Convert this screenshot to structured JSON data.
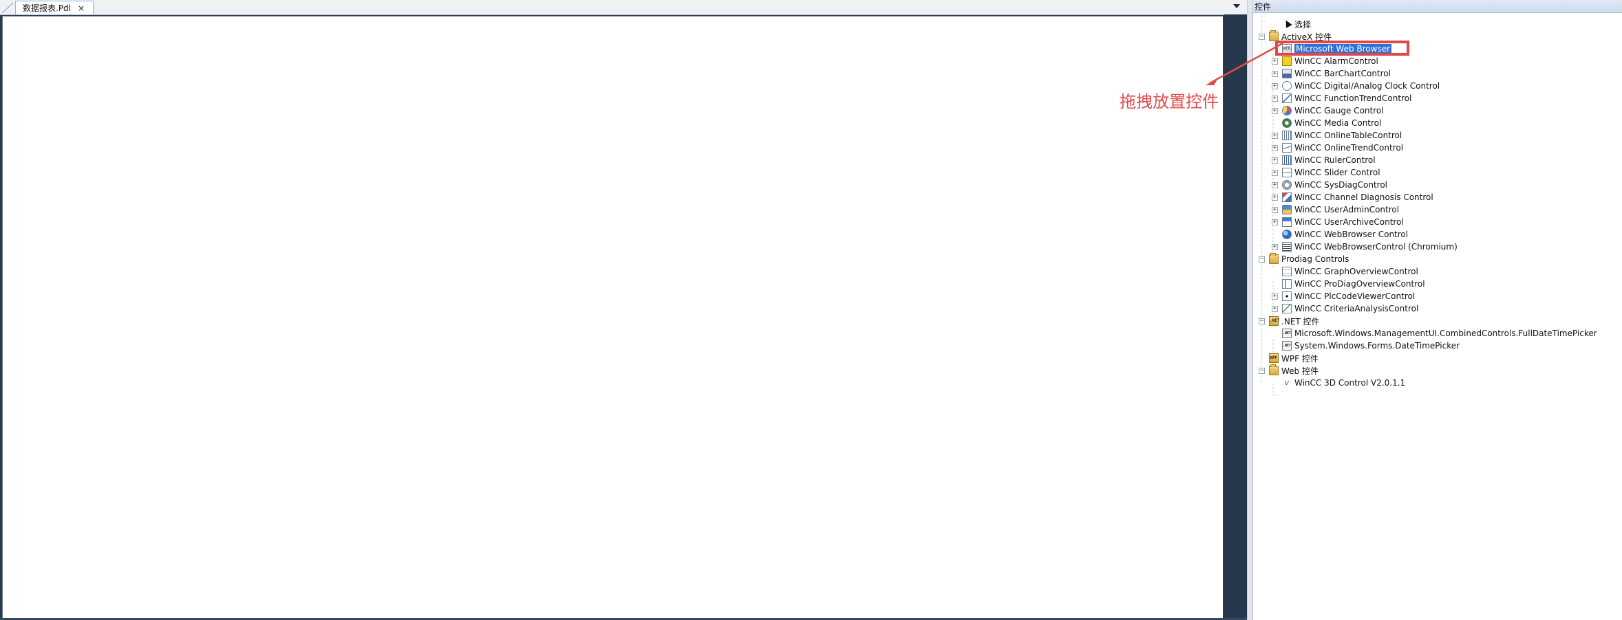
{
  "editor": {
    "tab_title": "数据报表.Pdl",
    "close_glyph": "×"
  },
  "panel": {
    "title": "控件",
    "tree": [
      {
        "label": "选择",
        "icon": "pointer-icon",
        "toggle": "",
        "indent": 1
      },
      {
        "label": "ActiveX 控件",
        "icon": "folder-icon",
        "toggle": "−",
        "indent": 0
      },
      {
        "label": "Microsoft Web Browser",
        "icon": "web-browser-icon",
        "toggle": "",
        "indent": 1,
        "selected": true
      },
      {
        "label": "WinCC AlarmControl",
        "icon": "alarm-control-icon",
        "toggle": "+",
        "indent": 1
      },
      {
        "label": "WinCC BarChartControl",
        "icon": "bar-chart-icon",
        "toggle": "+",
        "indent": 1
      },
      {
        "label": "WinCC Digital/Analog Clock Control",
        "icon": "clock-icon",
        "toggle": "+",
        "indent": 1
      },
      {
        "label": "WinCC FunctionTrendControl",
        "icon": "function-trend-icon",
        "toggle": "+",
        "indent": 1
      },
      {
        "label": "WinCC Gauge Control",
        "icon": "gauge-icon",
        "toggle": "+",
        "indent": 1
      },
      {
        "label": "WinCC Media Control",
        "icon": "media-icon",
        "toggle": "",
        "indent": 1
      },
      {
        "label": "WinCC OnlineTableControl",
        "icon": "online-table-icon",
        "toggle": "+",
        "indent": 1
      },
      {
        "label": "WinCC OnlineTrendControl",
        "icon": "online-trend-icon",
        "toggle": "+",
        "indent": 1
      },
      {
        "label": "WinCC RulerControl",
        "icon": "ruler-icon",
        "toggle": "+",
        "indent": 1
      },
      {
        "label": "WinCC Slider Control",
        "icon": "slider-icon",
        "toggle": "+",
        "indent": 1
      },
      {
        "label": "WinCC SysDiagControl",
        "icon": "sysdiag-icon",
        "toggle": "+",
        "indent": 1
      },
      {
        "label": "WinCC Channel Diagnosis Control",
        "icon": "channel-diagnosis-icon",
        "toggle": "+",
        "indent": 1
      },
      {
        "label": "WinCC UserAdminControl",
        "icon": "user-admin-icon",
        "toggle": "+",
        "indent": 1
      },
      {
        "label": "WinCC UserArchiveControl",
        "icon": "user-archive-icon",
        "toggle": "+",
        "indent": 1
      },
      {
        "label": "WinCC WebBrowser Control",
        "icon": "web-icon",
        "toggle": "",
        "indent": 1
      },
      {
        "label": "WinCC WebBrowserControl (Chromium)",
        "icon": "browser-chromium-icon",
        "toggle": "+",
        "indent": 1
      },
      {
        "label": "Prodiag Controls",
        "icon": "folder-icon",
        "toggle": "−",
        "indent": 0
      },
      {
        "label": "WinCC GraphOverviewControl",
        "icon": "graph-overview-icon",
        "toggle": "",
        "indent": 1
      },
      {
        "label": "WinCC ProDiagOverviewControl",
        "icon": "prodiag-overview-icon",
        "toggle": "",
        "indent": 1
      },
      {
        "label": "WinCC PlcCodeViewerControl",
        "icon": "plc-code-viewer-icon",
        "toggle": "+",
        "indent": 1
      },
      {
        "label": "WinCC CriteriaAnalysisControl",
        "icon": "criteria-analysis-icon",
        "toggle": "+",
        "indent": 1
      },
      {
        "label": ".NET 控件",
        "icon": "net-folder-icon",
        "toggle": "−",
        "indent": 0
      },
      {
        "label": "Microsoft.Windows.ManagementUI.CombinedControls.FullDateTimePicker",
        "icon": "net-control-icon",
        "toggle": "",
        "indent": 1
      },
      {
        "label": "System.Windows.Forms.DateTimePicker",
        "icon": "net-control-icon",
        "toggle": "",
        "indent": 1
      },
      {
        "label": "WPF 控件",
        "icon": "wpf-folder-icon",
        "toggle": "",
        "indent": 0
      },
      {
        "label": "Web 控件",
        "icon": "folder-icon",
        "toggle": "−",
        "indent": 0
      },
      {
        "label": "WinCC 3D Control V2.0.1.1",
        "icon": "wincc-3d-icon",
        "toggle": "",
        "indent": 1
      }
    ]
  },
  "annotation": {
    "text": "拖拽放置控件",
    "color": "#e14b4b"
  }
}
